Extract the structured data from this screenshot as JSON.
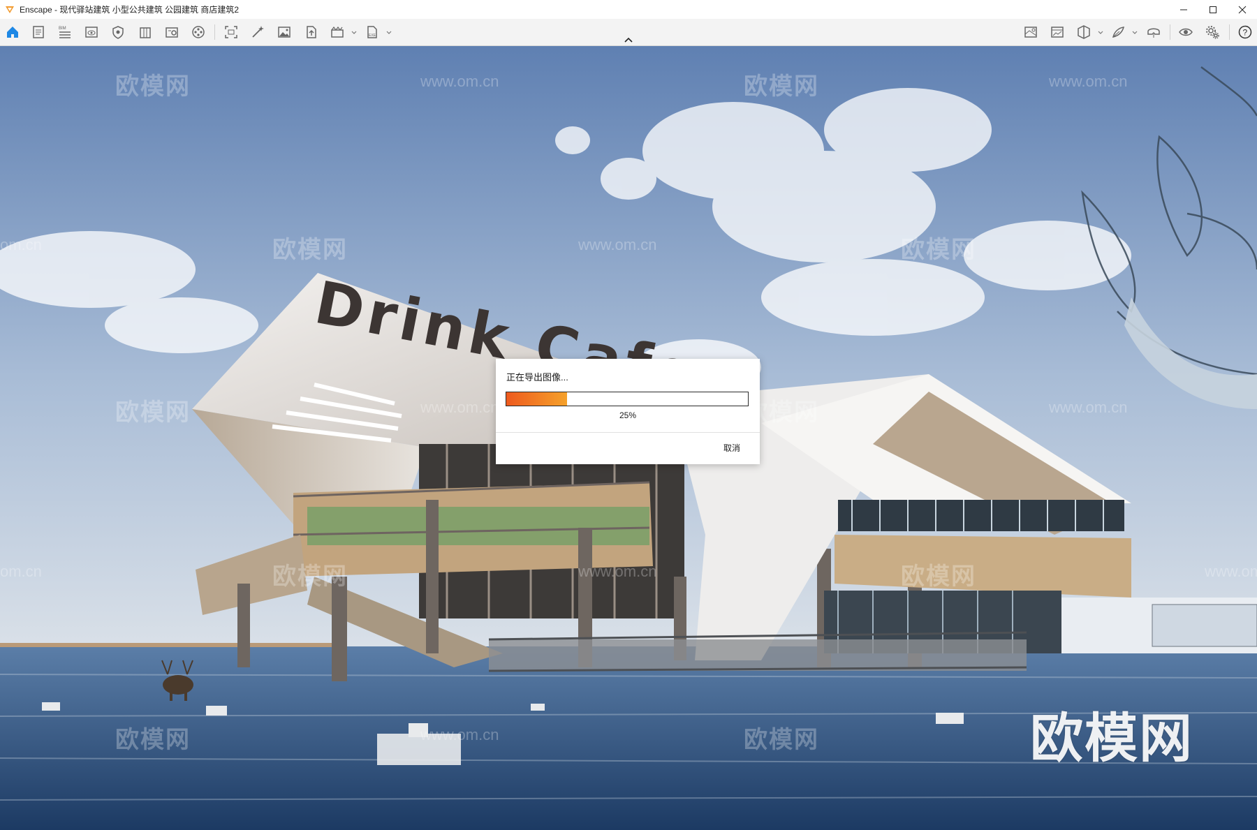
{
  "window": {
    "title": "Enscape - 现代驿站建筑 小型公共建筑 公园建筑 商店建筑2",
    "controls": [
      "minimize-icon",
      "maximize-icon",
      "close-icon"
    ]
  },
  "toolbar": {
    "left_buttons": [
      {
        "name": "home-icon",
        "active": true
      },
      {
        "name": "document-icon"
      },
      {
        "name": "bim-icon",
        "label": "BIM"
      },
      {
        "name": "view-eye-icon"
      },
      {
        "name": "shield-icon"
      },
      {
        "name": "building-icon"
      },
      {
        "name": "asset-library-icon"
      },
      {
        "name": "video-reel-icon"
      },
      {
        "name": "screenshot-icon"
      },
      {
        "name": "magic-wand-icon"
      },
      {
        "name": "image-icon"
      },
      {
        "name": "upload-icon"
      },
      {
        "name": "batch-render-icon",
        "has_dropdown": true
      },
      {
        "name": "export-file-icon",
        "has_dropdown": true
      }
    ],
    "right_buttons": [
      {
        "name": "map-icon"
      },
      {
        "name": "gallery-icon"
      },
      {
        "name": "cube-view-icon",
        "has_dropdown": true
      },
      {
        "name": "feather-icon",
        "has_dropdown": true
      },
      {
        "name": "vr-headset-icon"
      },
      {
        "name": "visibility-icon"
      },
      {
        "name": "settings-icon"
      },
      {
        "name": "help-icon"
      }
    ],
    "accent_color": "#1e88e5"
  },
  "viewport": {
    "sign_text": "Drink  Cafe",
    "watermark_cn": "欧模网",
    "watermark_url": "www.om.cn",
    "watermark_url_partial": "om.cn",
    "big_watermark": "欧模网"
  },
  "dialog": {
    "title": "正在导出图像...",
    "progress": 0.25,
    "progress_label": "25%",
    "cancel_label": "取消",
    "progress_colors": [
      "#ee5a1e",
      "#f5a12a"
    ]
  }
}
